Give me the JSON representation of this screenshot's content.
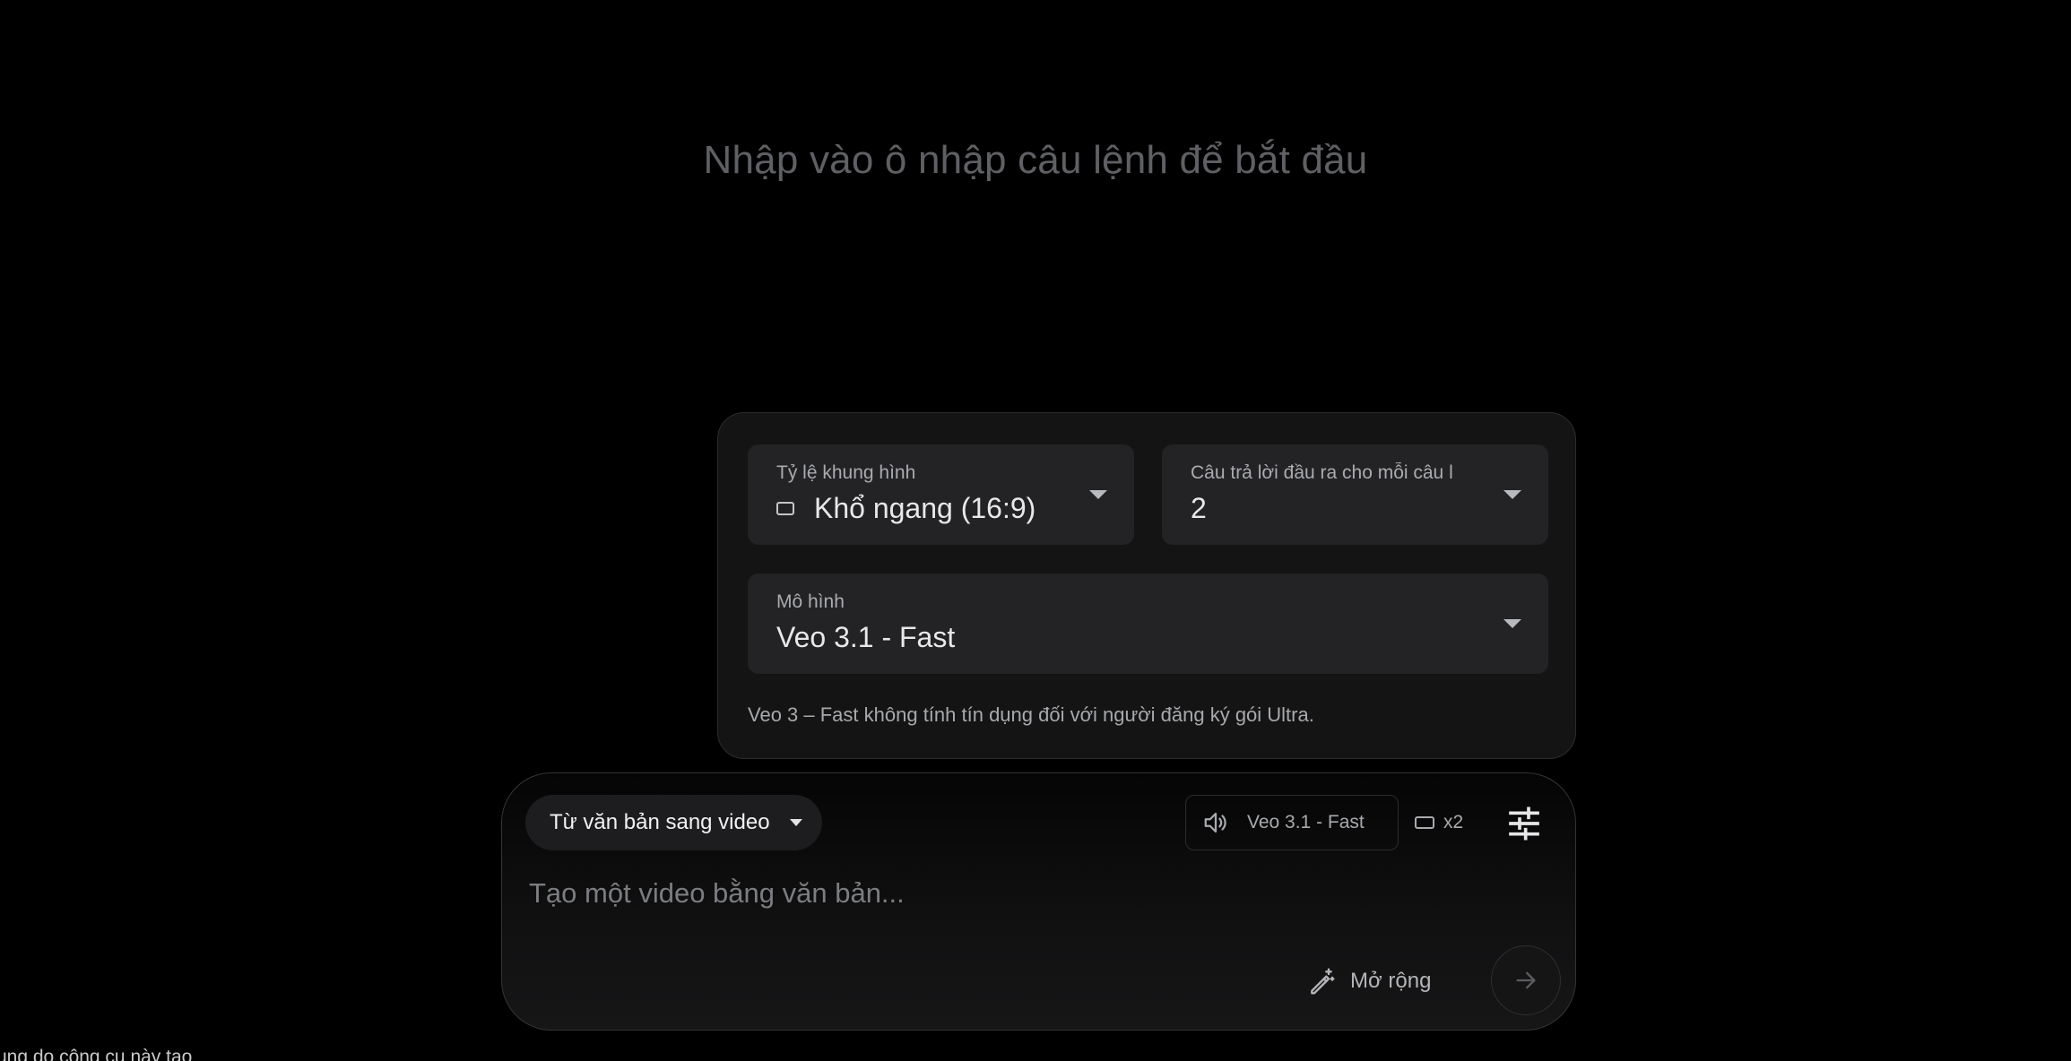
{
  "hero": {
    "title": "Nhập vào ô nhập câu lệnh để bắt đầu"
  },
  "settings_panel": {
    "aspect_ratio": {
      "label": "Tỷ lệ khung hình",
      "value": "Khổ ngang (16:9)",
      "icon": "landscape-rectangle-icon"
    },
    "outputs_per_prompt": {
      "label": "Câu trả lời đầu ra cho mỗi câu l",
      "value": "2"
    },
    "model": {
      "label": "Mô hình",
      "value": "Veo 3.1 - Fast"
    },
    "note": "Veo 3 – Fast không tính tín dụng đối với người đăng ký gói Ultra."
  },
  "composer": {
    "mode_label": "Từ văn bản sang video",
    "model_chip_label": "Veo 3.1 - Fast",
    "aspect_count": "x2",
    "prompt_placeholder": "Tạo một video bằng văn bản...",
    "prompt_value": "",
    "expand_label": "Mở rộng"
  },
  "footer": {
    "fragment": "ung do công cụ này tạo"
  },
  "colors": {
    "background": "#000000",
    "panel": "#141414",
    "field": "#232325",
    "hero_text": "#5f6064"
  }
}
